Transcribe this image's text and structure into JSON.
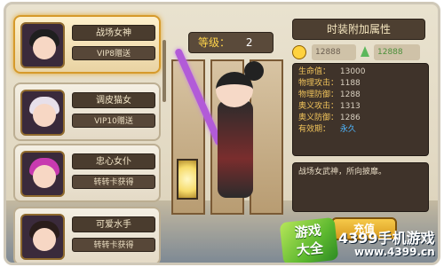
{
  "characters": [
    {
      "name": "战场女神",
      "obtain": "VIP8赠送",
      "selected": true,
      "hair_color": "#1f1f1f"
    },
    {
      "name": "调皮猫女",
      "obtain": "VIP10赠送",
      "selected": false,
      "hair_color": "#e7e0ea"
    },
    {
      "name": "忠心女仆",
      "obtain": "转转卡获得",
      "selected": false,
      "hair_color": "#c83ab0"
    },
    {
      "name": "可爱水手",
      "obtain": "转转卡获得",
      "selected": false,
      "hair_color": "#2a1d1b"
    }
  ],
  "level": {
    "label": "等级：",
    "value": "2"
  },
  "attributes": {
    "title": "时装附加属性",
    "power_old": "12888",
    "power_new": "12888",
    "stats": [
      {
        "label": "生命值：",
        "value": "13000"
      },
      {
        "label": "物理攻击：",
        "value": "1188"
      },
      {
        "label": "物理防御：",
        "value": "1288"
      },
      {
        "label": "奥义攻击：",
        "value": "1313"
      },
      {
        "label": "奥义防御：",
        "value": "1286"
      },
      {
        "label": "有效期：",
        "value": "永久"
      }
    ]
  },
  "description": "战场女武神，所向披靡。",
  "equip_button": "充值",
  "watermark": {
    "logo_line1": "游戏",
    "logo_line2": "大全",
    "site": "4399手机游戏",
    "url": "www.4399.cn"
  },
  "colors": {
    "accent_gold": "#d69a2b",
    "panel_dark": "#3f332a",
    "sword_purple": "#b25bd8"
  }
}
